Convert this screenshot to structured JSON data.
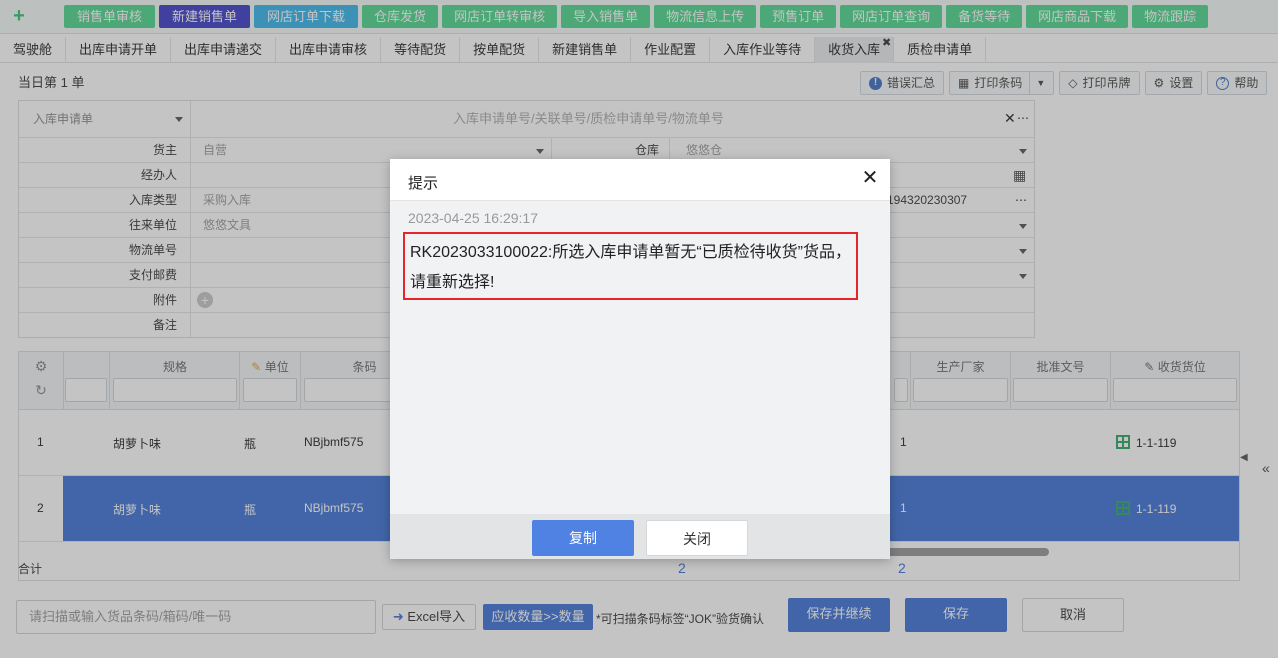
{
  "top_nav": {
    "plus_icon": "plus-icon",
    "buttons": [
      "销售单审核",
      "新建销售单",
      "网店订单下载",
      "仓库发货",
      "网店订单转审核",
      "导入销售单",
      "物流信息上传",
      "预售订单",
      "网店订单查询",
      "备货等待",
      "网店商品下载",
      "物流跟踪"
    ]
  },
  "tabs": [
    "驾驶舱",
    "出库申请开单",
    "出库申请递交",
    "出库申请审核",
    "等待配货",
    "按单配货",
    "新建销售单",
    "作业配置",
    "入库作业等待",
    "收货入库",
    "质检申请单"
  ],
  "header": {
    "day_title": "当日第 1 单",
    "tools": {
      "error_summary": "错误汇总",
      "print_barcode": "打印条码",
      "print_tag": "打印吊牌",
      "settings": "设置",
      "help": "帮助"
    }
  },
  "form": {
    "type_select": "入库申请单",
    "search_placeholder": "入库申请单号/关联单号/质检申请单号/物流单号",
    "owner_label": "货主",
    "owner_value": "自营",
    "warehouse_label": "仓库",
    "warehouse_value": "悠悠仓",
    "handler_label": "经办人",
    "inbound_type_label": "入库类型",
    "inbound_type_value": "采购入库",
    "ref_number": "194320230307",
    "partner_label": "往来单位",
    "partner_value": "悠悠文具",
    "logistics_label": "物流单号",
    "postage_label": "支付邮费",
    "attachment_label": "附件",
    "remark_label": "备注"
  },
  "grid": {
    "columns": {
      "spec": "规格",
      "unit": "单位",
      "barcode": "条码",
      "manufacturer": "生产厂家",
      "approval_no": "批准文号",
      "location": "收货货位"
    },
    "rows": [
      {
        "no": "1",
        "spec": "胡萝卜味",
        "unit": "瓶",
        "barcode": "NBjbmf575",
        "qty": "1",
        "location": "1-1-119"
      },
      {
        "no": "2",
        "spec": "胡萝卜味",
        "unit": "瓶",
        "barcode": "NBjbmf575",
        "qty": "1",
        "location": "1-1-119"
      }
    ],
    "total_label": "合计",
    "total_a": "2",
    "total_b": "2"
  },
  "bottom": {
    "scan_placeholder": "请扫描或输入货品条码/箱码/唯一码",
    "excel_import": "Excel导入",
    "qty_button": "应收数量>>数量",
    "hint": "*可扫描条码标签“JOK”验货确认",
    "save_continue": "保存并继续",
    "save": "保存",
    "cancel": "取消"
  },
  "dialog": {
    "title": "提示",
    "timestamp": "2023-04-25 16:29:17",
    "message": "RK2023033100022:所选入库申请单暂无“已质检待收货”货品，请重新选择!",
    "copy_button": "复制",
    "close_button": "关闭"
  },
  "colors": {
    "nav_green": "#4fd68d",
    "nav_purple": "#3d3fc7",
    "nav_cyan": "#35b6ea",
    "primary_blue": "#3f73d6",
    "alert_red": "#e5242b"
  }
}
